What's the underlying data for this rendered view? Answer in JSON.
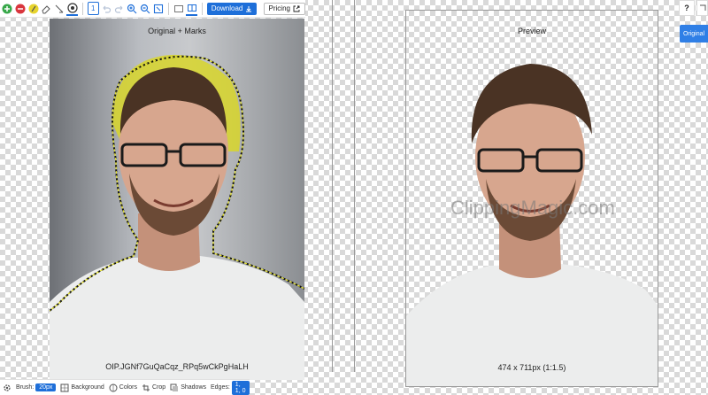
{
  "toolbar": {
    "zoom_value": "1",
    "download_label": "Download",
    "pricing_label": "Pricing"
  },
  "original": {
    "title": "Original + Marks",
    "filename": "OIP.JGNf7GuQaCqz_RPq5wCkPgHaLH"
  },
  "preview": {
    "title": "Preview",
    "watermark": "ClippingMagic.com",
    "dimensions": "474 x 711px (1:1.5)"
  },
  "side": {
    "help_label": "?",
    "original_label": "Original"
  },
  "bottom": {
    "brush_label": "Brush:",
    "brush_size": "20px",
    "background_label": "Background",
    "colors_label": "Colors",
    "crop_label": "Crop",
    "shadows_label": "Shadows",
    "edges_label": "Edges:",
    "edges_value": "1, 1, 0"
  },
  "colors": {
    "accent": "#1e6fd9",
    "keep_green": "#38a84a",
    "remove_red": "#d9363e",
    "hair_mark": "#d8d62a"
  }
}
